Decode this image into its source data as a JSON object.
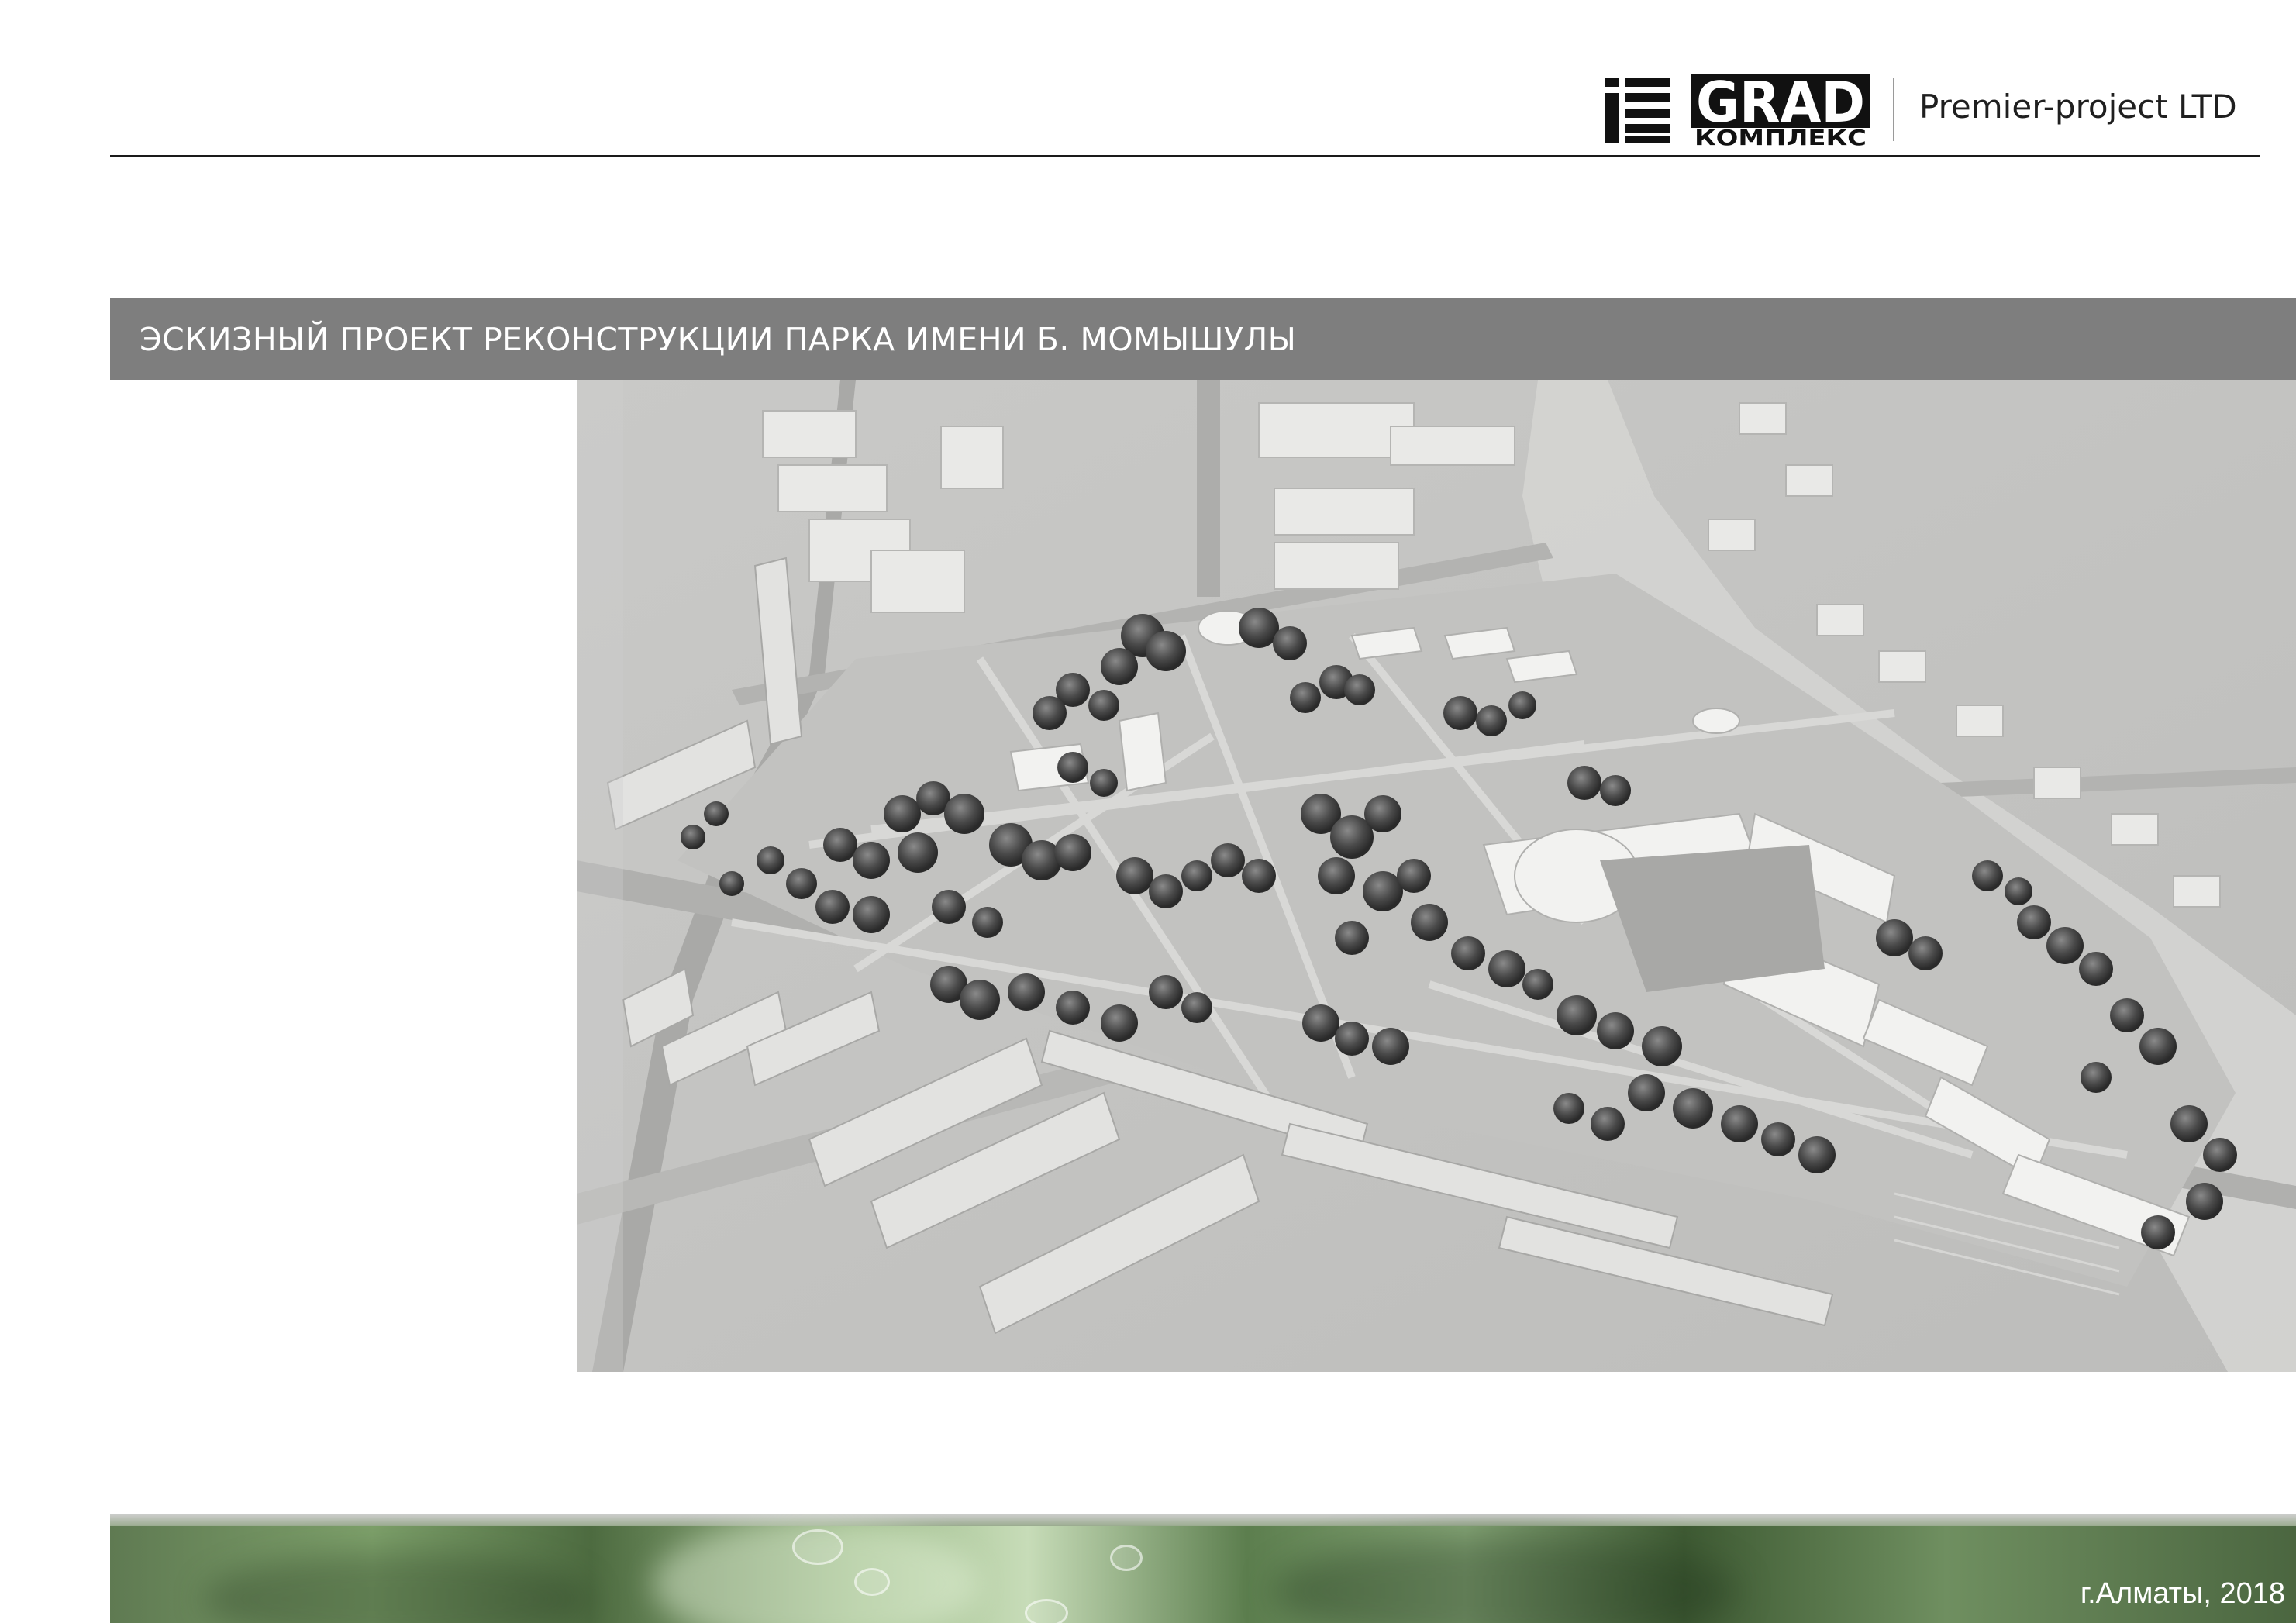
{
  "header": {
    "logo": {
      "name": "grad-kompleks-logo",
      "wordmark": "GRAD",
      "subtext": "КОМПЛЕКС"
    },
    "company": "Premier-project LTD"
  },
  "title_bar": {
    "title": "ЭСКИЗНЫЙ ПРОЕКТ РЕКОНСТРУКЦИИ ПАРКА ИМЕНИ Б. МОМЫШУЛЫ"
  },
  "render": {
    "description_icon": "aerial-park-model-render"
  },
  "footer": {
    "city_date": "г.Алматы, 2018"
  },
  "colors": {
    "title_bar_bg": "#7e7e7e",
    "rule": "#1a1a1a",
    "footer_green": "#6f8f60"
  }
}
